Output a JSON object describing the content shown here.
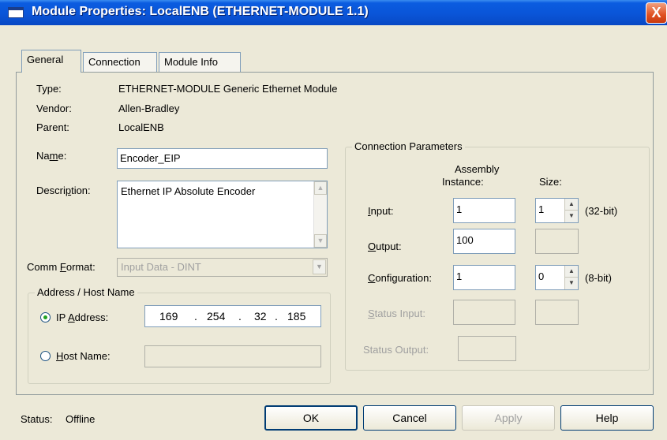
{
  "window": {
    "title": "Module Properties: LocalENB (ETHERNET-MODULE 1.1)",
    "close_glyph": "X"
  },
  "tabs": [
    {
      "label": "General",
      "active": true
    },
    {
      "label": "Connection",
      "active": false
    },
    {
      "label": "Module Info",
      "active": false
    }
  ],
  "general": {
    "type_label": "Type:",
    "type_value": "ETHERNET-MODULE Generic Ethernet Module",
    "vendor_label": "Vendor:",
    "vendor_value": "Allen-Bradley",
    "parent_label": "Parent:",
    "parent_value": "LocalENB",
    "name_label_pre": "Na",
    "name_label_key": "m",
    "name_label_post": "e:",
    "name_value": "Encoder_EIP",
    "desc_label_pre": "Descri",
    "desc_label_key": "p",
    "desc_label_post": "tion:",
    "desc_value": "Ethernet IP Absolute Encoder",
    "comm_label_pre": "Comm ",
    "comm_label_key": "F",
    "comm_label_post": "ormat:",
    "comm_value": "Input Data - DINT"
  },
  "address": {
    "group_title": "Address / Host Name",
    "ip_label_pre": "IP ",
    "ip_label_key": "A",
    "ip_label_post": "ddress:",
    "ip_selected": true,
    "ip_octets": [
      "169",
      "254",
      "32",
      "185"
    ],
    "ip_dot": ".",
    "host_label_key": "H",
    "host_label_post": "ost Name:",
    "host_value": ""
  },
  "connection_params": {
    "group_title": "Connection Parameters",
    "col_assembly_line1": "Assembly",
    "col_assembly_line2": "Instance:",
    "col_size": "Size:",
    "input_label_key": "I",
    "input_label_post": "nput:",
    "input_instance": "1",
    "input_size": "1",
    "input_unit": "(32-bit)",
    "output_label_key": "O",
    "output_label_post": "utput:",
    "output_instance": "100",
    "config_label_key": "C",
    "config_label_post": "onfiguration:",
    "config_instance": "1",
    "config_size": "0",
    "config_unit": "(8-bit)",
    "status_input_label_key": "S",
    "status_input_label_post": "tatus Input:",
    "status_output_label": "Status Output:"
  },
  "status": {
    "label": "Status:",
    "value": "Offline"
  },
  "buttons": {
    "ok": "OK",
    "cancel": "Cancel",
    "apply": "Apply",
    "help": "Help"
  },
  "icons": {
    "app": "window-icon",
    "close": "close-icon",
    "scroll_up": "▲",
    "scroll_down": "▼",
    "combo_arrow": "▼",
    "spin_up": "▲",
    "spin_down": "▼"
  },
  "colors": {
    "titlebar": "#0a55d8",
    "face": "#ece9d8",
    "close": "#e05020"
  }
}
